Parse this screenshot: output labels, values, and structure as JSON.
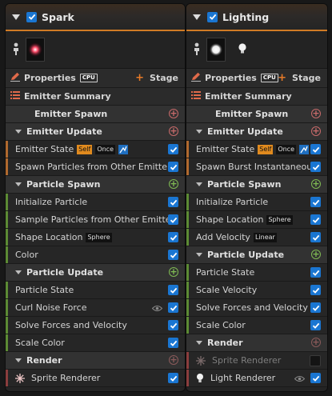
{
  "panels": [
    {
      "title": "Spark",
      "properties_label": "Properties",
      "cpu_label": "CPU",
      "stage_label": "Stage",
      "summary_label": "Emitter Summary",
      "sections": [
        {
          "label": "Emitter Spawn",
          "collapsible": false,
          "add_color": "red",
          "items": []
        },
        {
          "label": "Emitter Update",
          "collapsible": true,
          "add_color": "red",
          "items": [
            {
              "label": "Emitter State",
              "badges": [
                "Self",
                "Once"
              ],
              "has_icon": true,
              "color": "orange",
              "checked": true
            },
            {
              "label": "Spawn Particles from Other Emitter",
              "color": "orange",
              "checked": true
            }
          ]
        },
        {
          "label": "Particle Spawn",
          "collapsible": true,
          "add_color": "green",
          "items": [
            {
              "label": "Initialize Particle",
              "color": "green",
              "checked": true
            },
            {
              "label": "Sample Particles from Other Emitter",
              "color": "green",
              "checked": true
            },
            {
              "label": "Shape Location",
              "badges": [
                "Sphere"
              ],
              "color": "green",
              "checked": true
            },
            {
              "label": "Color",
              "color": "green",
              "checked": true
            }
          ]
        },
        {
          "label": "Particle Update",
          "collapsible": true,
          "add_color": "green",
          "items": [
            {
              "label": "Particle State",
              "color": "green",
              "checked": true
            },
            {
              "label": "Curl Noise Force",
              "color": "green",
              "checked": true,
              "eye": true
            },
            {
              "label": "Solve Forces and Velocity",
              "color": "green",
              "checked": true
            },
            {
              "label": "Scale Color",
              "color": "green",
              "checked": true
            }
          ]
        },
        {
          "label": "Render",
          "collapsible": true,
          "add_color": "dim",
          "renderers": [
            {
              "label": "Sprite Renderer",
              "icon": "sprite-renderer-icon",
              "checked": true,
              "enabled": true
            }
          ]
        }
      ]
    },
    {
      "title": "Lighting",
      "properties_label": "Properties",
      "cpu_label": "CPU",
      "stage_label": "Stage",
      "summary_label": "Emitter Summary",
      "sections": [
        {
          "label": "Emitter Spawn",
          "collapsible": false,
          "add_color": "red",
          "items": []
        },
        {
          "label": "Emitter Update",
          "collapsible": true,
          "add_color": "red",
          "items": [
            {
              "label": "Emitter State",
              "badges": [
                "Self",
                "Once"
              ],
              "has_icon": true,
              "color": "orange",
              "checked": true
            },
            {
              "label": "Spawn Burst Instantaneous",
              "color": "orange",
              "checked": true
            }
          ]
        },
        {
          "label": "Particle Spawn",
          "collapsible": true,
          "add_color": "green",
          "items": [
            {
              "label": "Initialize Particle",
              "color": "green",
              "checked": true
            },
            {
              "label": "Shape Location",
              "badges": [
                "Sphere"
              ],
              "color": "green",
              "checked": true
            },
            {
              "label": "Add Velocity",
              "badges": [
                "Linear"
              ],
              "color": "green",
              "checked": true
            }
          ]
        },
        {
          "label": "Particle Update",
          "collapsible": true,
          "add_color": "green",
          "items": [
            {
              "label": "Particle State",
              "color": "green",
              "checked": true
            },
            {
              "label": "Scale Velocity",
              "color": "green",
              "checked": true
            },
            {
              "label": "Solve Forces and Velocity",
              "color": "green",
              "checked": true
            },
            {
              "label": "Scale Color",
              "color": "green",
              "checked": true
            }
          ]
        },
        {
          "label": "Render",
          "collapsible": true,
          "add_color": "dim",
          "renderers": [
            {
              "label": "Sprite Renderer",
              "icon": "sprite-renderer-icon",
              "checked": false,
              "enabled": false
            },
            {
              "label": "Light Renderer",
              "icon": "light-renderer-icon",
              "checked": true,
              "enabled": true,
              "eye": true
            }
          ]
        }
      ]
    }
  ],
  "colors": {
    "accent_orange": "#d07b25",
    "checkbox_blue": "#1a76d2",
    "spawn_green": "#7fba53",
    "update_red": "#c86a6a"
  }
}
